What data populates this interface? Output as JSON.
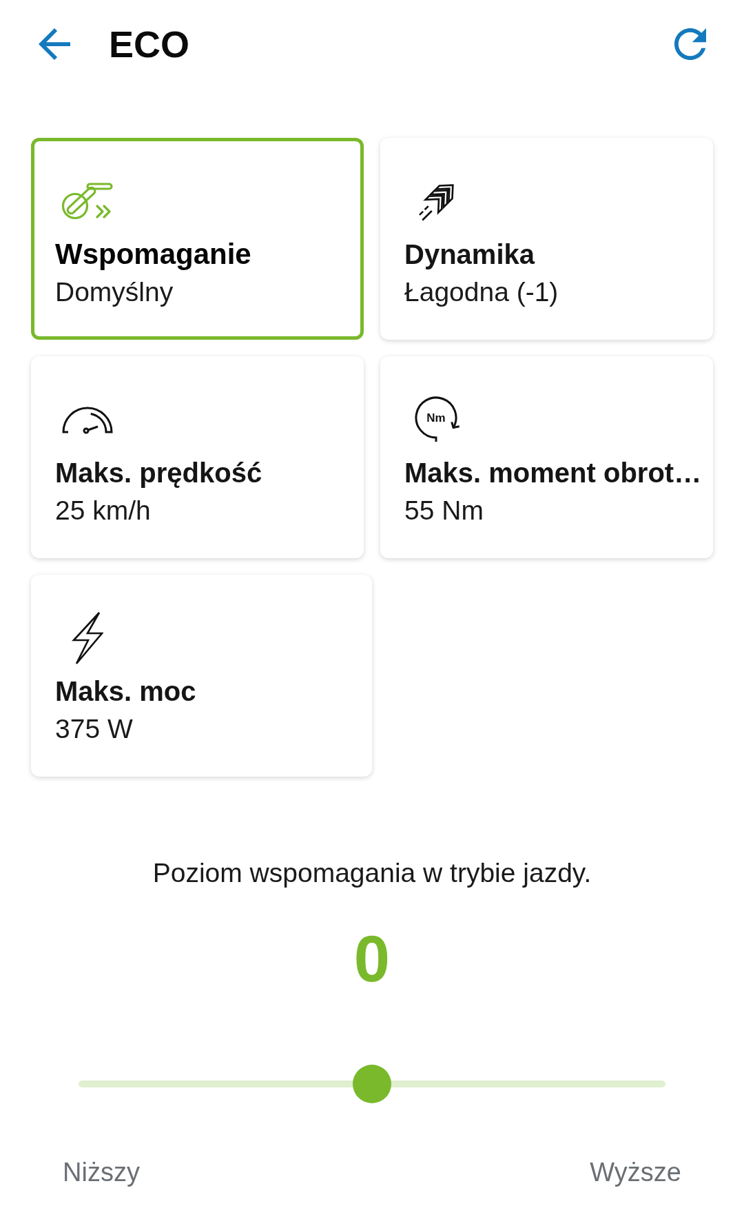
{
  "header": {
    "title": "ECO"
  },
  "cards": [
    {
      "kind": "assist",
      "title": "Wspomaganie",
      "value": "Domyślny",
      "selected": true
    },
    {
      "kind": "dynamics",
      "title": "Dynamika",
      "value": "Łagodna (-1)",
      "selected": false
    },
    {
      "kind": "speed",
      "title": "Maks. prędkość",
      "value": "25 km/h",
      "selected": false
    },
    {
      "kind": "torque",
      "title": "Maks. moment obrot…",
      "value": "55 Nm",
      "selected": false
    },
    {
      "kind": "power",
      "title": "Maks. moc",
      "value": "375 W",
      "selected": false
    }
  ],
  "torque_icon": {
    "label": "Nm"
  },
  "description": "Poziom wspomagania w trybie jazdy.",
  "assist_level": "0",
  "slider": {
    "level": 0.5,
    "min_label": "Niższy",
    "max_label": "Wyższe"
  }
}
